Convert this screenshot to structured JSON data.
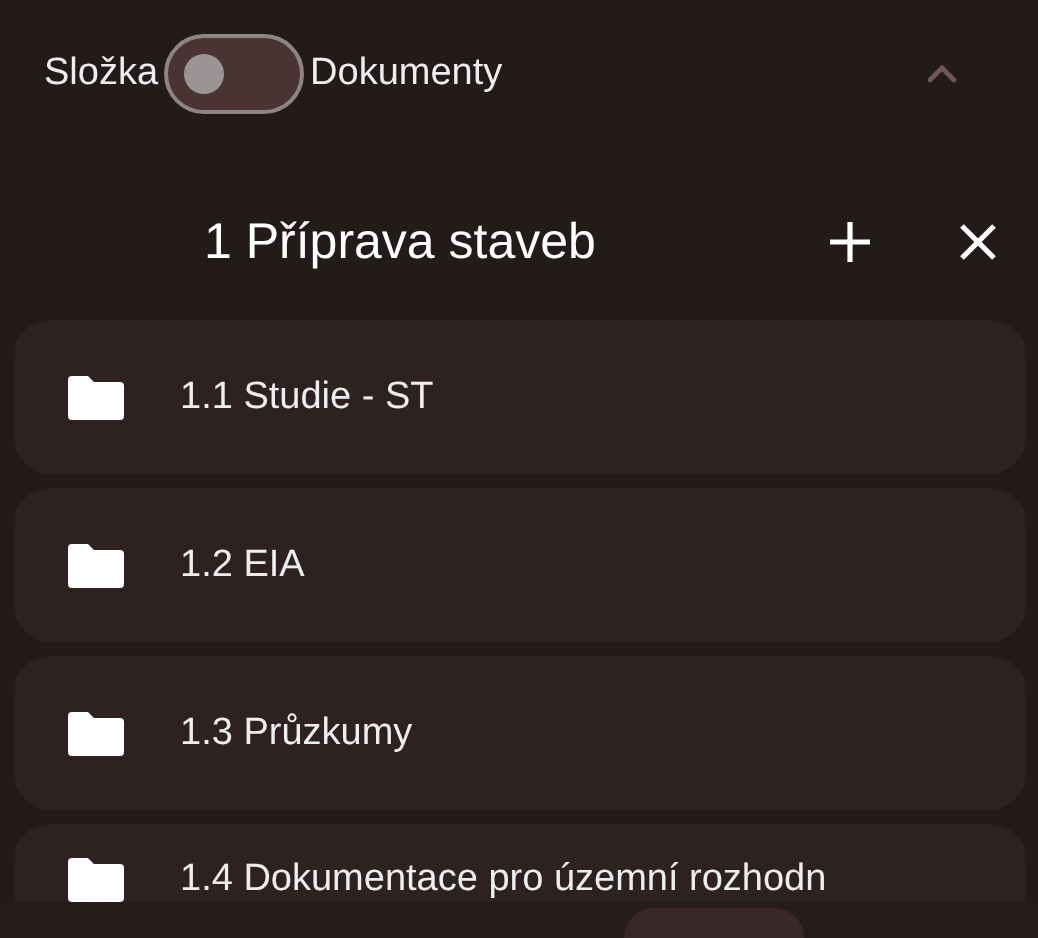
{
  "header": {
    "toggle": {
      "left_label": "Složka",
      "right_label": "Dokumenty",
      "on": false
    }
  },
  "title": "1 Příprava staveb",
  "folders": [
    {
      "label": "1.1 Studie - ST"
    },
    {
      "label": "1.2 EIA"
    },
    {
      "label": "1.3 Průzkumy"
    },
    {
      "label": "1.4 Dokumentace pro územní rozhodn"
    }
  ]
}
